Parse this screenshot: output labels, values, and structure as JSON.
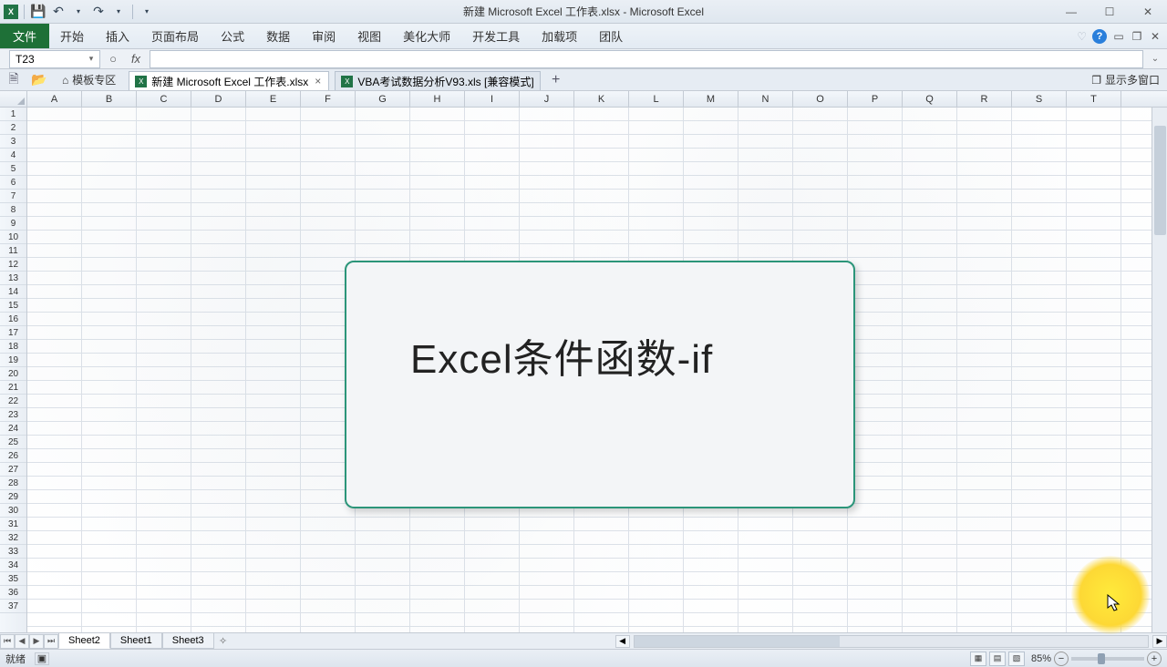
{
  "title": "新建 Microsoft Excel 工作表.xlsx - Microsoft Excel",
  "ribbon": {
    "file": "文件",
    "tabs": [
      "开始",
      "插入",
      "页面布局",
      "公式",
      "数据",
      "审阅",
      "视图",
      "美化大师",
      "开发工具",
      "加载项",
      "团队"
    ]
  },
  "name_box": "T23",
  "formula": "",
  "doctabs": {
    "template_zone": "模板专区",
    "tabs": [
      {
        "label": "新建 Microsoft Excel 工作表.xlsx",
        "active": true,
        "closeable": true
      },
      {
        "label": "VBA考试数据分析V93.xls  [兼容模式]",
        "active": false,
        "closeable": false
      }
    ],
    "multi_window": "显示多窗口"
  },
  "columns": [
    "A",
    "B",
    "C",
    "D",
    "E",
    "F",
    "G",
    "H",
    "I",
    "J",
    "K",
    "L",
    "M",
    "N",
    "O",
    "P",
    "Q",
    "R",
    "S",
    "T"
  ],
  "rows": [
    "1",
    "2",
    "3",
    "4",
    "5",
    "6",
    "7",
    "8",
    "9",
    "10",
    "11",
    "12",
    "13",
    "14",
    "15",
    "16",
    "17",
    "18",
    "19",
    "20",
    "21",
    "22",
    "23",
    "24",
    "25",
    "26",
    "27",
    "28",
    "29",
    "30",
    "31",
    "32",
    "33",
    "34",
    "35",
    "36",
    "37"
  ],
  "shape_text": "Excel条件函数-if",
  "sheets": {
    "list": [
      "Sheet2",
      "Sheet1",
      "Sheet3"
    ],
    "active": "Sheet2"
  },
  "status": {
    "ready": "就绪",
    "zoom": "85%"
  }
}
